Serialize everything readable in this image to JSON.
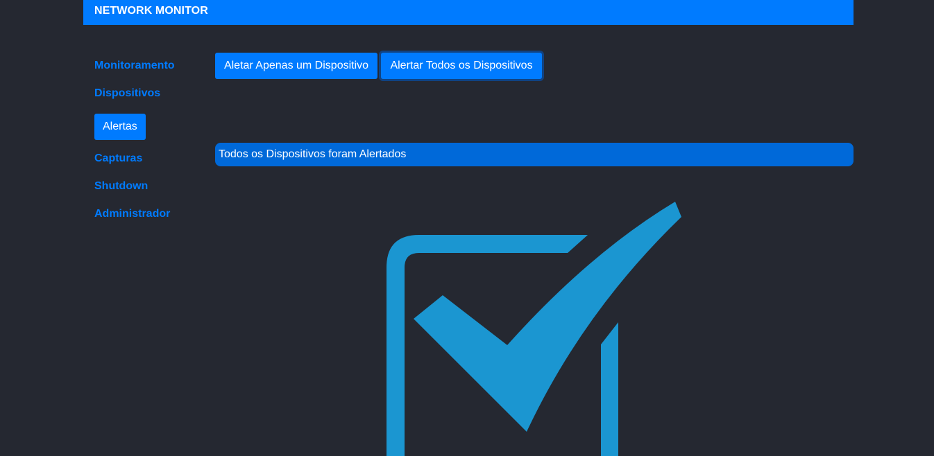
{
  "header": {
    "brand": "NETWORK MONITOR"
  },
  "sidebar": {
    "items": [
      {
        "label": "Monitoramento",
        "active": false
      },
      {
        "label": "Dispositivos",
        "active": false
      },
      {
        "label": "Alertas",
        "active": true
      },
      {
        "label": "Capturas",
        "active": false
      },
      {
        "label": "Shutdown",
        "active": false
      },
      {
        "label": "Administrador",
        "active": false
      }
    ]
  },
  "actions": {
    "alert_one_label": "Aletar Apenas um Dispositivo",
    "alert_all_label": "Alertar Todos os Dispositivos"
  },
  "status": {
    "message": "Todos os Dispositivos foram Alertados"
  },
  "graphic": {
    "icon": "checkbox-checked-icon",
    "color": "#1b96d1"
  },
  "colors": {
    "accent": "#007bff",
    "background": "#252831",
    "banner": "#0069d9"
  }
}
